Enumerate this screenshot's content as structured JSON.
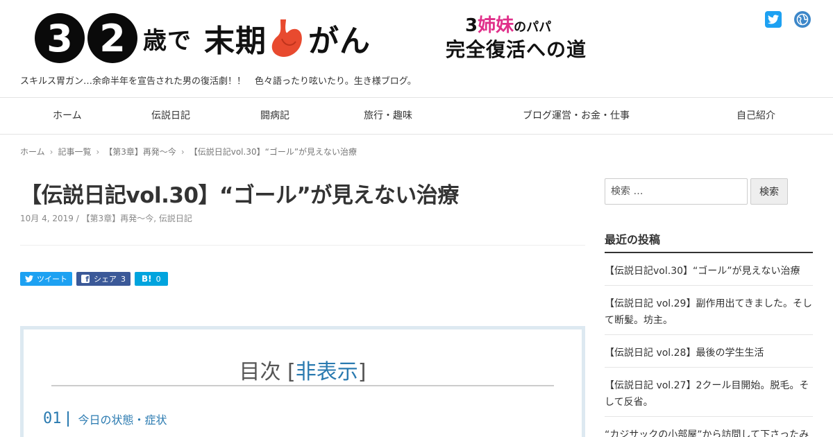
{
  "header": {
    "logo": {
      "num1": "3",
      "num2": "2",
      "text1": "歳で",
      "text2": "末期",
      "text3": "がん",
      "sub_num": "3",
      "sub_pink": "姉妹",
      "sub_small": "のパパ",
      "sub_bottom": "完全復活への道"
    },
    "tagline": "スキルス胃ガン…余命半年を宣告された男の復活劇！！　色々語ったり呟いたり。生き様ブログ。"
  },
  "nav": {
    "items": [
      "ホーム",
      "伝説日記",
      "闘病記",
      "旅行・趣味",
      "ブログ運営・お金・仕事",
      "自己紹介"
    ]
  },
  "breadcrumb": [
    "ホーム",
    "記事一覧",
    "【第3章】再発〜今",
    "【伝説日記vol.30】“ゴール”が見えない治療"
  ],
  "article": {
    "title": "【伝説日記vol.30】“ゴール”が見えない治療",
    "meta": "10月 4, 2019 / 【第3章】再発〜今, 伝説日記"
  },
  "share": {
    "tweet": "ツイート",
    "facebook": "シェア",
    "facebook_count": "3",
    "hatena_count": "0"
  },
  "toc": {
    "title": "目次",
    "toggle": "非表示",
    "items": [
      {
        "num": "01",
        "text": "今日の状態・症状"
      }
    ]
  },
  "sidebar": {
    "search_placeholder": "検索 …",
    "search_button": "検索",
    "recent_title": "最近の投稿",
    "recent_posts": [
      "【伝説日記vol.30】“ゴール”が見えない治療",
      "【伝説日記 vol.29】副作用出てきました。そして断髪。坊主。",
      "【伝説日記 vol.28】最後の学生生活",
      "【伝説日記 vol.27】2クール目開始。脱毛。そして反省。",
      "“カジサックの小部屋”から訪問して下さったみ"
    ]
  },
  "colors": {
    "accent": "#2a7ab0",
    "twitter": "#1da1f2",
    "facebook": "#3b5998",
    "hatena": "#00a4de",
    "logo_pink": "#e0308a",
    "stomach": "#e84a2f"
  }
}
